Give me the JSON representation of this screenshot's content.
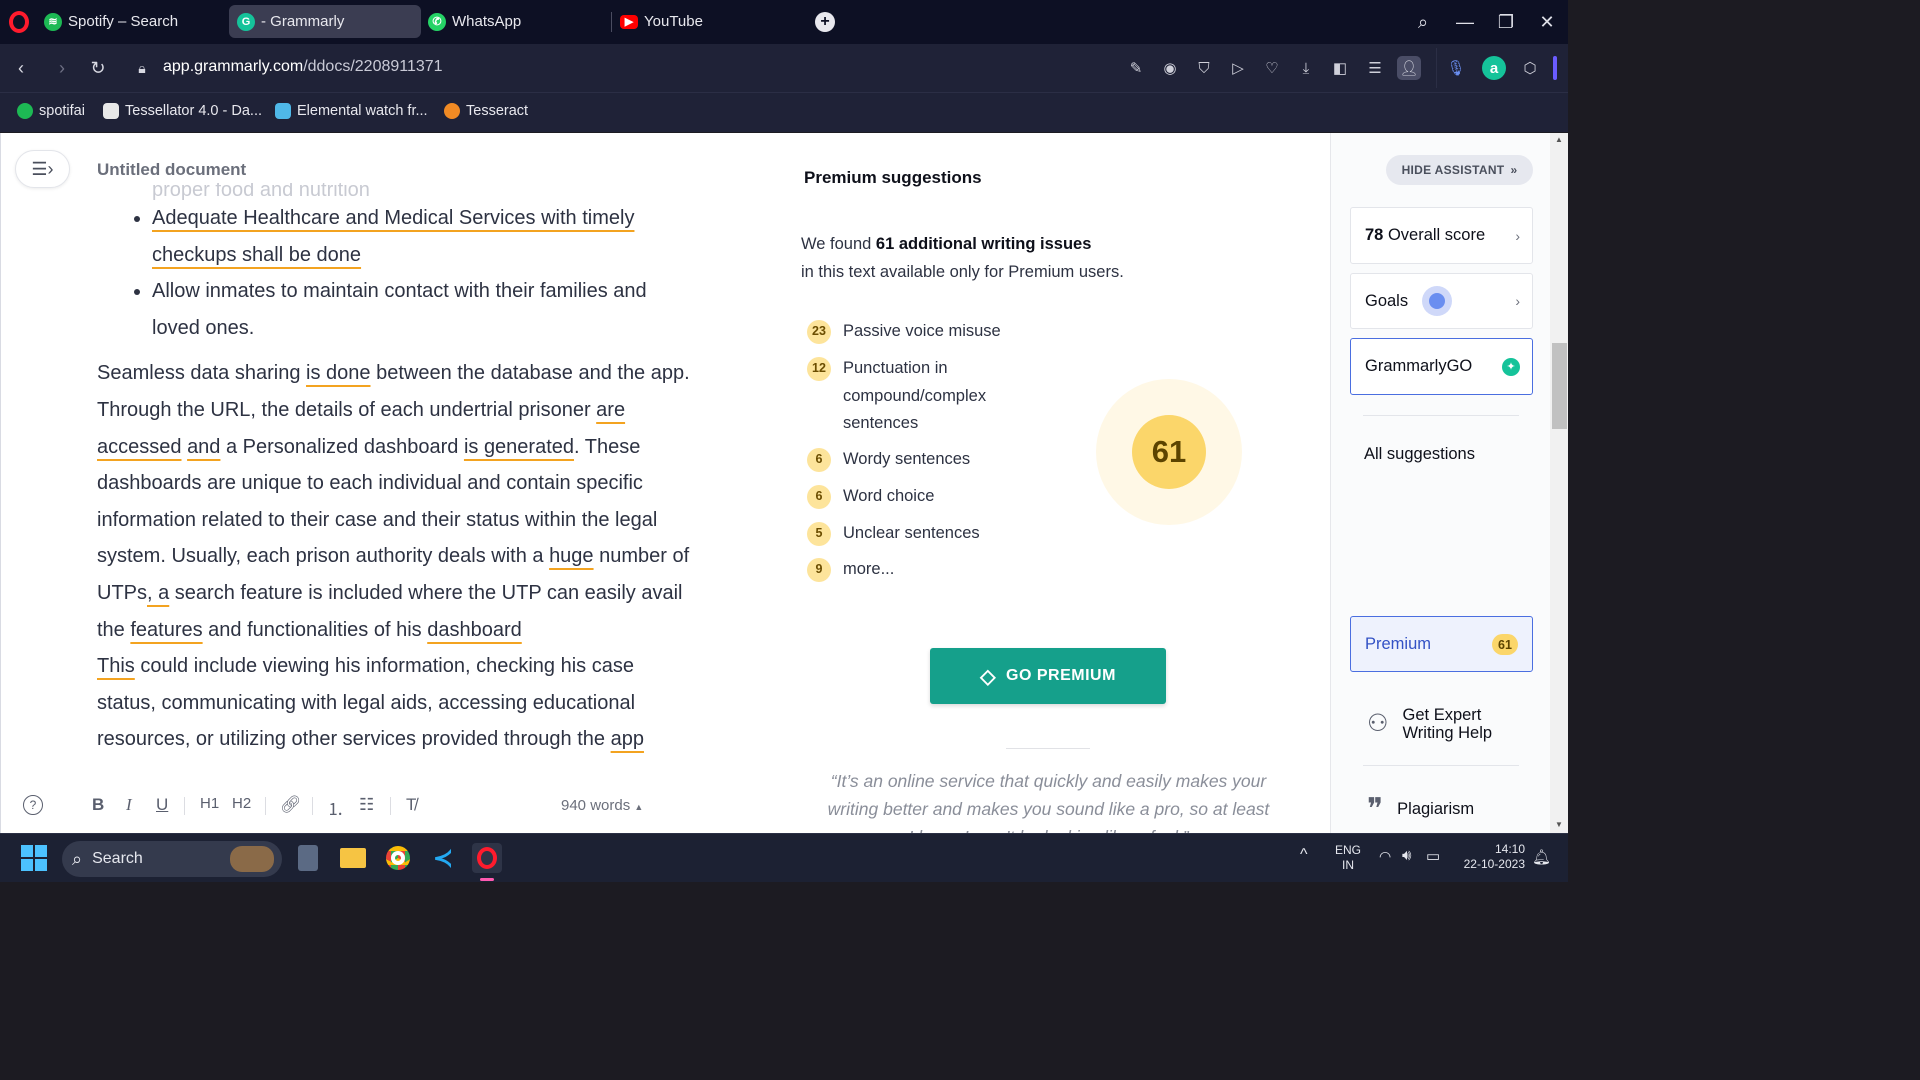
{
  "browser": {
    "tabs": [
      {
        "label": "Spotify – Search",
        "color": "#1db954"
      },
      {
        "label": "- Grammarly",
        "color": "#15c39a",
        "active": true
      },
      {
        "label": "WhatsApp",
        "color": "#25d366"
      },
      {
        "label": "YouTube",
        "color": "#ff0000"
      }
    ],
    "url_domain": "app.grammarly.com",
    "url_path": "/ddocs/2208911371",
    "bookmarks": [
      {
        "label": "spotifai",
        "color": "#1db954"
      },
      {
        "label": "Tessellator 4.0 - Da...",
        "color": "#e8e8e8"
      },
      {
        "label": "Elemental watch fr...",
        "color": "#4fb8e8"
      },
      {
        "label": "Tesseract",
        "color": "#f08a24"
      }
    ]
  },
  "doc": {
    "title": "Untitled document",
    "faded_line": "proper food and nutrition",
    "bullet1_part1": "Adequate Healthcare and Medical Services with timely",
    "bullet1_part2": "checkups shall be done",
    "bullet2": "Allow inmates to maintain contact with their families and loved ones.",
    "p1": {
      "t1": "Seamless data sharing ",
      "u1": "is done",
      "t2": " between the database and the app. Through the URL, the details of each undertrial prisoner ",
      "u2": "are accessed",
      "t3": " ",
      "u3": "and",
      "t4": " a Personalized dashboard ",
      "u4": "is generated",
      "t5": ". These dashboards are unique to each individual and contain specific information related to their case and their status within the legal system. Usually, each prison authority deals with a ",
      "u5": "huge",
      "t6": " number of UTPs",
      "u6": ", a",
      "t7": " search feature is included where the UTP can easily avail the ",
      "u7": "features",
      "t8": " and functionalities of his ",
      "u8": "dashboard"
    },
    "p2": {
      "u1": "This",
      "t1": " could include viewing his information, checking his case status, communicating with legal aids, accessing educational resources, or utilizing other services provided through the ",
      "u2": "app"
    },
    "word_count": "940 words"
  },
  "toolbar": {
    "bold": "B",
    "italic": "I",
    "underline": "U",
    "h1": "H1",
    "h2": "H2"
  },
  "premium": {
    "title": "Premium suggestions",
    "found_prefix": "We found ",
    "found_bold": "61 additional writing issues",
    "found_suffix": "in this text available only for Premium users.",
    "issues": [
      {
        "count": "23",
        "label": "Passive voice misuse"
      },
      {
        "count": "12",
        "label": "Punctuation in compound/complex sentences"
      },
      {
        "count": "6",
        "label": "Wordy sentences"
      },
      {
        "count": "6",
        "label": "Word choice"
      },
      {
        "count": "5",
        "label": "Unclear sentences"
      },
      {
        "count": "9",
        "label": "more..."
      }
    ],
    "score": "61",
    "button": "GO PREMIUM",
    "quote": "“It’s an online service that quickly and easily makes your writing better and makes you sound like a pro, so at least I know I won’t be looking like a fool.”"
  },
  "assistant": {
    "hide": "HIDE ASSISTANT",
    "overall_score": "78",
    "overall_label": "Overall score",
    "goals": "Goals",
    "grammarly_go": "GrammarlyGO",
    "all_suggestions": "All suggestions",
    "premium": "Premium",
    "premium_count": "61",
    "expert": "Get Expert Writing Help",
    "plagiarism": "Plagiarism"
  },
  "taskbar": {
    "search": "Search",
    "lang1": "ENG",
    "lang2": "IN",
    "time": "14:10",
    "date": "22-10-2023"
  }
}
